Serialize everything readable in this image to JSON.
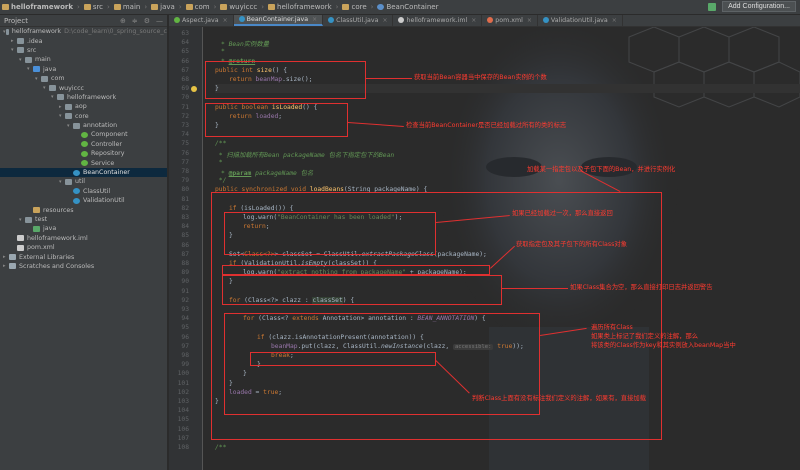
{
  "breadcrumb": {
    "items": [
      {
        "label": "helloframework",
        "bold": true
      },
      {
        "label": "src"
      },
      {
        "label": "main"
      },
      {
        "label": "java"
      },
      {
        "label": "com"
      },
      {
        "label": "wuyiccc"
      },
      {
        "label": "helloframework"
      },
      {
        "label": "core"
      },
      {
        "label": "BeanContainer",
        "icon": "class"
      }
    ],
    "add_config_label": "Add Configuration..."
  },
  "project_panel": {
    "title": "Project",
    "tools": [
      "⊕",
      "≑",
      "⚙",
      "—"
    ],
    "tree": [
      {
        "depth": 0,
        "arrow": "▾",
        "icon": "folder",
        "label": "helloframework",
        "extra": "D:\\code_learn\\0_spring_source_c"
      },
      {
        "depth": 1,
        "arrow": "▸",
        "icon": "folder",
        "label": ".idea"
      },
      {
        "depth": 1,
        "arrow": "▾",
        "icon": "folder",
        "label": "src"
      },
      {
        "depth": 2,
        "arrow": "▾",
        "icon": "folder",
        "label": "main"
      },
      {
        "depth": 3,
        "arrow": "▾",
        "icon": "src",
        "label": "java"
      },
      {
        "depth": 4,
        "arrow": "▾",
        "icon": "folder",
        "label": "com"
      },
      {
        "depth": 5,
        "arrow": "▾",
        "icon": "folder",
        "label": "wuyiccc"
      },
      {
        "depth": 6,
        "arrow": "▾",
        "icon": "folder",
        "label": "helloframework"
      },
      {
        "depth": 7,
        "arrow": "▸",
        "icon": "folder",
        "label": "aop"
      },
      {
        "depth": 7,
        "arrow": "▾",
        "icon": "folder",
        "label": "core"
      },
      {
        "depth": 8,
        "arrow": "▾",
        "icon": "folder",
        "label": "annotation"
      },
      {
        "depth": 9,
        "arrow": "",
        "icon": "anno",
        "label": "Component"
      },
      {
        "depth": 9,
        "arrow": "",
        "icon": "anno",
        "label": "Controller"
      },
      {
        "depth": 9,
        "arrow": "",
        "icon": "anno",
        "label": "Repository"
      },
      {
        "depth": 9,
        "arrow": "",
        "icon": "anno",
        "label": "Service"
      },
      {
        "depth": 8,
        "arrow": "",
        "icon": "class",
        "label": "BeanContainer",
        "selected": true
      },
      {
        "depth": 7,
        "arrow": "▾",
        "icon": "folder",
        "label": "util"
      },
      {
        "depth": 8,
        "arrow": "",
        "icon": "class",
        "label": "ClassUtil"
      },
      {
        "depth": 8,
        "arrow": "",
        "icon": "class",
        "label": "ValidationUtil"
      },
      {
        "depth": 3,
        "arrow": "",
        "icon": "res",
        "label": "resources"
      },
      {
        "depth": 2,
        "arrow": "▾",
        "icon": "folder",
        "label": "test"
      },
      {
        "depth": 3,
        "arrow": "",
        "icon": "test",
        "label": "java"
      },
      {
        "depth": 1,
        "arrow": "",
        "icon": "file",
        "label": "helloframework.iml"
      },
      {
        "depth": 1,
        "arrow": "",
        "icon": "file",
        "label": "pom.xml"
      },
      {
        "depth": 0,
        "arrow": "▸",
        "icon": "lib",
        "label": "External Libraries"
      },
      {
        "depth": 0,
        "arrow": "▸",
        "icon": "lib",
        "label": "Scratches and Consoles"
      }
    ]
  },
  "tabs": [
    {
      "label": "Aspect.java",
      "color": "#62b543"
    },
    {
      "label": "BeanContainer.java",
      "color": "#3592c4",
      "active": true
    },
    {
      "label": "ClassUtil.java",
      "color": "#3592c4"
    },
    {
      "label": "helloframework.iml",
      "color": "#cccccc"
    },
    {
      "label": "pom.xml",
      "color": "#e06c4c"
    },
    {
      "label": "ValidationUtil.java",
      "color": "#3592c4"
    }
  ],
  "editor": {
    "line_numbers": [
      "63",
      "64",
      "65",
      "66",
      "67",
      "68",
      "69",
      "70",
      "71",
      "72",
      "73",
      "74",
      "75",
      "76",
      "77",
      "78",
      "79",
      "80",
      "81",
      "82",
      "83",
      "84",
      "85",
      "86",
      "87",
      "88",
      "89",
      "90",
      "91",
      "92",
      "93",
      "94",
      "95",
      "96",
      "97",
      "98",
      "99",
      "100",
      "101",
      "102",
      "103",
      "104",
      "105",
      "106",
      "107",
      "108"
    ],
    "code": {
      "l63": "",
      "l64": "* Bean实例数量",
      "l65": "*",
      "l66_tag": "@return",
      "l67_kw": "public int ",
      "l67_fn": "size",
      "l67_rest": "() {",
      "l68_kw": "return ",
      "l68_fd": "beanMap",
      "l68_rest": ".size();",
      "l69": "}",
      "l70": "",
      "l71_kw": "public boolean ",
      "l71_fn": "isLoaded",
      "l71_rest": "() {",
      "l72_kw": "return ",
      "l72_fd": "loaded",
      "l72_rest": ";",
      "l73": "}",
      "l74": "",
      "l75": "/**",
      "l76_pre": " * 扫描加载所有Bean ",
      "l76_it": "packageName",
      "l76_post": " 包名下指定包下的Bean",
      "l77": " *",
      "l78_tag": "@param",
      "l78_param": "packageName",
      "l78_rest": " 包名",
      "l79": " */",
      "l80_kw": "public synchronized void ",
      "l80_fn": "loadBeans",
      "l80_rest": "(String packageName) {",
      "l81": "",
      "l82_kw": "if ",
      "l82_rest": "(isLoaded()) {",
      "l83_a": "log.warn(",
      "l83_st": "\"BeanContainer has been loaded\"",
      "l83_b": ");",
      "l84_kw": "return",
      "l84_rest": ";",
      "l85": "}",
      "l86": "",
      "l87_a": "Set<",
      "l87_b": "Class<?>",
      "l87_c": "> classSet = ClassUtil.",
      "l87_it": "extractPackageClass",
      "l87_d": "(packageName);",
      "l88_kw": "if ",
      "l88_a": "(ValidationUtil.",
      "l88_it": "isEmpty",
      "l88_b": "(classSet)) {",
      "l89_a": "log.warn(",
      "l89_st": "\"extract nothing from packageName\"",
      "l89_b": " + packageName);",
      "l90": "}",
      "l91": "",
      "l92_kw": "for ",
      "l92_a": "(Class<?> clazz : ",
      "l92_b": "classSet",
      "l92_c": ") {",
      "l93": "",
      "l94_kw": "for ",
      "l94_a": "(Class<? ",
      "l94_kw2": "extends ",
      "l94_b": "Annotation> annotation : ",
      "l94_cst": "BEAN_ANNOTATION",
      "l94_c": ") {",
      "l95": "",
      "l96_kw": "if ",
      "l96_rest": "(clazz.isAnnotationPresent(annotation)) {",
      "l97_a": "beanMap",
      "l97_b": ".put(clazz, ClassUtil.",
      "l97_it": "newInstance",
      "l97_c": "(clazz, ",
      "l97_hint": "accessible:",
      "l97_kw": " true",
      "l97_d": "));",
      "l98_kw": "break",
      "l98_rest": ";",
      "l99": "}",
      "l100": "}",
      "l101": "}",
      "l102_fd": "loaded",
      "l102_rest": " = ",
      "l102_kw": "true",
      "l102_end": ";",
      "l103": "}",
      "l104": "",
      "l105": "",
      "l106": "",
      "l107": "",
      "l108": "/**"
    }
  },
  "annotations": {
    "a1": "获取当前Bean容器当中保存的Bean实例的个数",
    "a2": "检查当前BeanContainer是否已经加载过所有的类的标志",
    "a3": "加载某一指定包以及子包下面的Bean，并进行实例化",
    "a4": "如果已经加载过一次，那么直接返回",
    "a5": "获取指定包及其子包下的所有Class对象",
    "a6": "如果Class集合为空，那么直接打印日志并返回警告",
    "a7": "遍历所有Class",
    "a7b": "如果类上标记了我们定义的注解，那么",
    "a7c": "将该类的Class作为key和其实例放入beanMap当中",
    "a8": "判断Class上面有没有标注我们定义的注解，如果有，直接加载"
  },
  "colors": {
    "annotation_red": "#e03030",
    "editor_bg": "#2b2b2b",
    "panel_bg": "#3c3f41"
  }
}
